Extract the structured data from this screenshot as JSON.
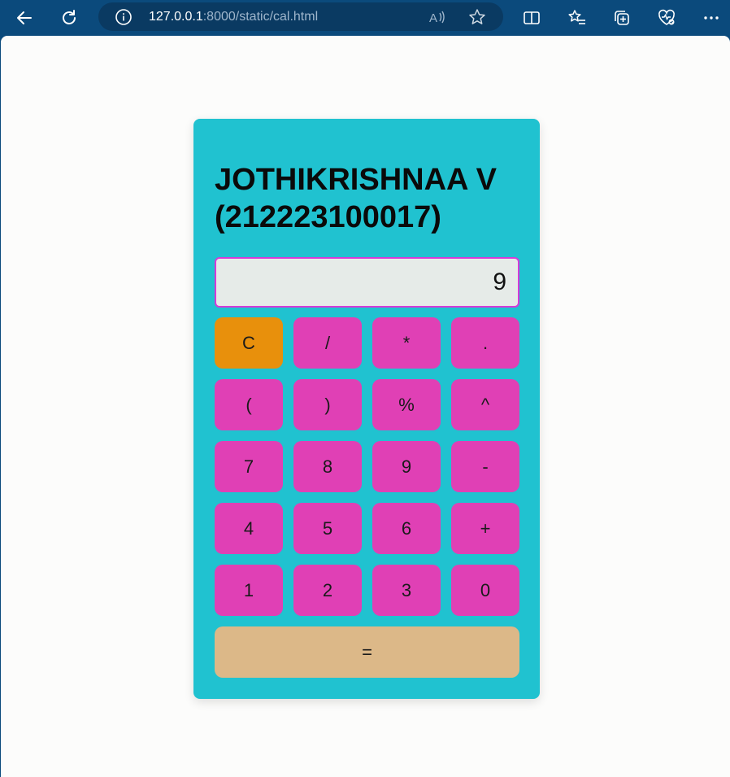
{
  "browser": {
    "url_host": "127.0.0.1",
    "url_rest": ":8000/static/cal.html",
    "icons": [
      "back-icon",
      "refresh-icon",
      "info-icon",
      "read-aloud-icon",
      "favorite-star-icon",
      "split-screen-icon",
      "favorites-icon",
      "collections-icon",
      "browser-essentials-icon",
      "more-icon"
    ]
  },
  "calculator": {
    "title_line1": "JOTHIKRISHNAA V",
    "title_line2": "(212223100017)",
    "display_value": "9",
    "colors": {
      "panel": "#20c2d0",
      "key": "#e040b5",
      "clear_key": "#e8900c",
      "equals_key": "#dcb888",
      "display_border": "#d53bd8"
    },
    "keys": {
      "clear": "C",
      "divide": "/",
      "multiply": "*",
      "decimal": ".",
      "open_paren": "(",
      "close_paren": ")",
      "percent": "%",
      "power": "^",
      "seven": "7",
      "eight": "8",
      "nine": "9",
      "minus": "-",
      "four": "4",
      "five": "5",
      "six": "6",
      "plus": "+",
      "one": "1",
      "two": "2",
      "three": "3",
      "zero": "0",
      "equals": "="
    }
  }
}
